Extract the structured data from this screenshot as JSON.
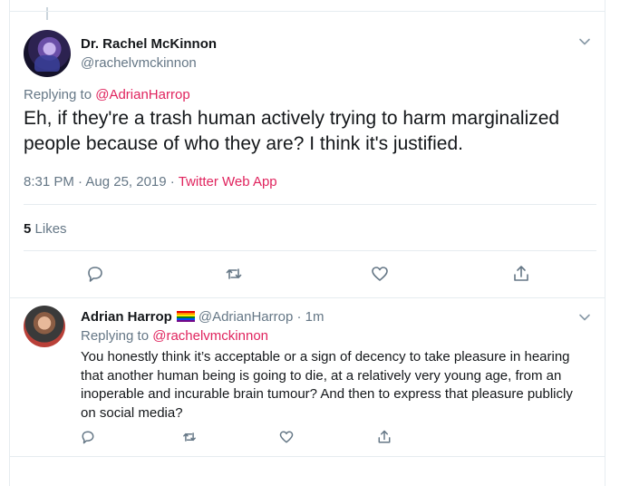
{
  "main_tweet": {
    "author_name": "Dr. Rachel McKinnon",
    "author_handle": "@rachelvmckinnon",
    "replying_prefix": "Replying to",
    "replying_to": "@AdrianHarrop",
    "text": "Eh, if they're a trash human actively trying to harm marginalized people because of who they are? I think it's justified.",
    "time": "8:31 PM · Aug 25, 2019 ·",
    "source": "Twitter Web App",
    "likes_count": "5",
    "likes_label": "Likes"
  },
  "reply_tweet": {
    "author_name": "Adrian Harrop",
    "author_handle": "@AdrianHarrop",
    "time": "· 1m",
    "replying_prefix": "Replying to",
    "replying_to": "@rachelvmckinnon",
    "text": "You honestly think it’s acceptable or a sign of decency to take pleasure in hearing that another human being is going to die, at a relatively very young age, from an inoperable and incurable brain tumour? And then to express that pleasure publicly on social media?"
  },
  "icons": {
    "reply": "reply-icon",
    "retweet": "retweet-icon",
    "like": "heart-icon",
    "share": "share-icon",
    "more": "chevron-down-icon",
    "flag": "rainbow-flag-icon"
  },
  "colors": {
    "accent": "#e0245e",
    "secondary_text": "#657786",
    "primary_text": "#14171a",
    "divider": "#e6ecf0"
  }
}
